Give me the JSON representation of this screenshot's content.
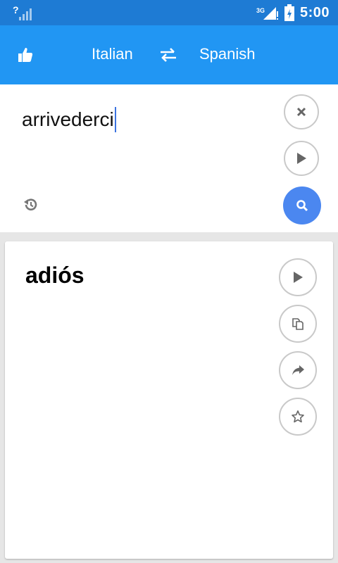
{
  "status_bar": {
    "signal_left_label": "?",
    "network_label": "3G",
    "clock": "5:00"
  },
  "header": {
    "source_language": "Italian",
    "target_language": "Spanish",
    "icons": {
      "like": "thumbs-up-icon",
      "swap": "swap-arrows-icon"
    }
  },
  "input": {
    "text": "arrivederci",
    "icons": {
      "clear": "close-icon",
      "play": "play-icon",
      "history": "history-icon",
      "search": "search-icon"
    }
  },
  "result": {
    "text": "adiós",
    "icons": {
      "play": "play-icon",
      "copy": "copy-icon",
      "share": "share-icon",
      "favorite": "star-icon"
    }
  },
  "colors": {
    "status_bar": "#1e7bd4",
    "app_bar": "#2196f3",
    "search_button": "#4b87f0",
    "background": "#e6e6e6"
  }
}
